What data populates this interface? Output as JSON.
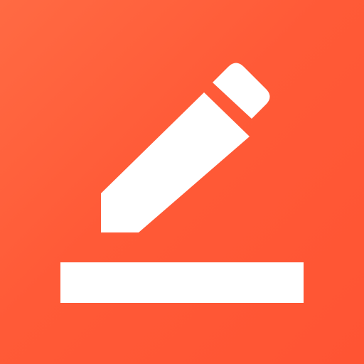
{
  "icon": {
    "name": "edit-note-icon",
    "background_color": "#ff5a37",
    "foreground_color": "#ffffff"
  }
}
